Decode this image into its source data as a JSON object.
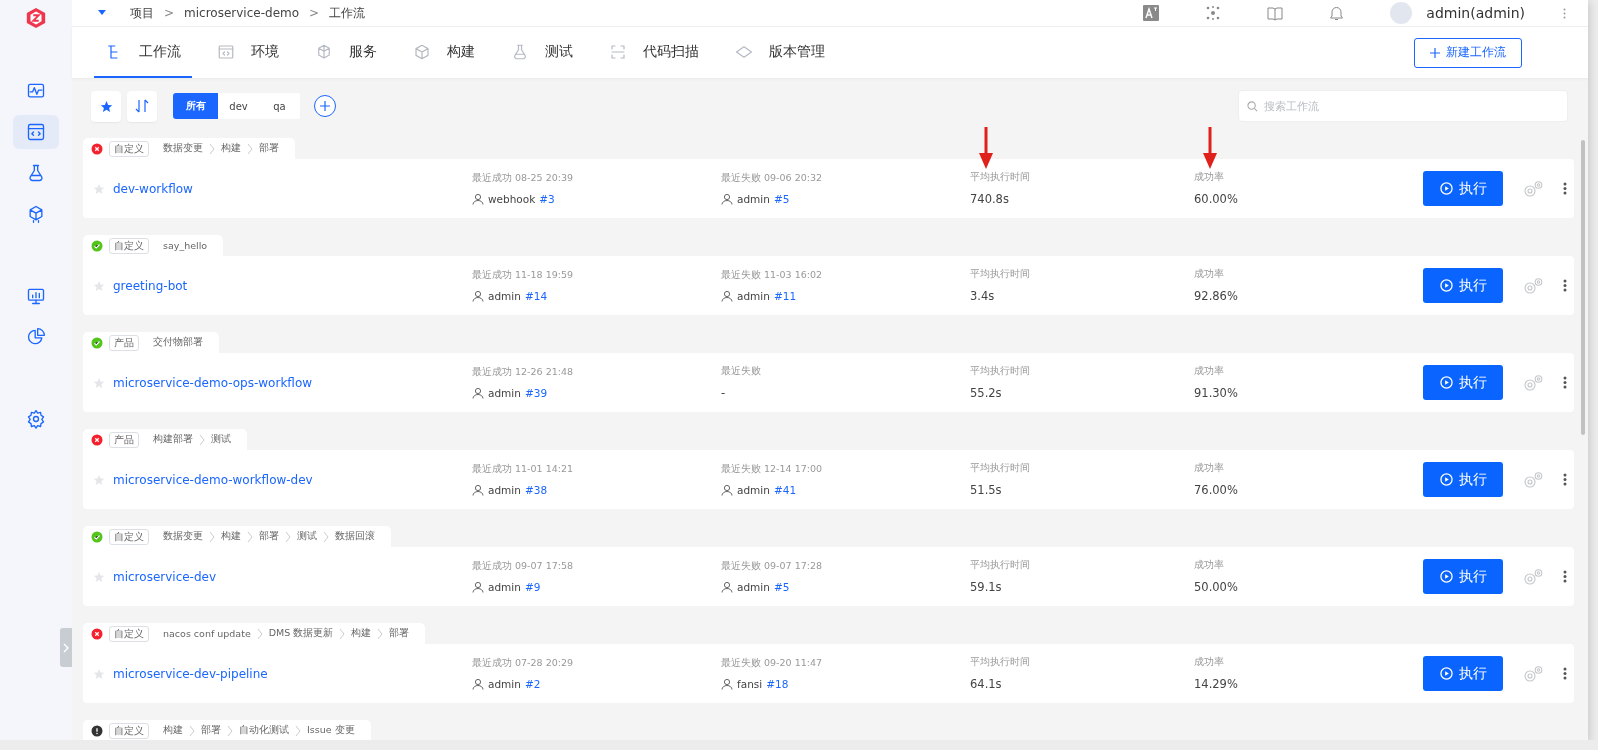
{
  "sidebar": {
    "groups": [
      [
        {
          "kind": "pulse",
          "selected": false
        },
        {
          "kind": "code",
          "selected": true
        },
        {
          "kind": "flask",
          "selected": false
        },
        {
          "kind": "cube",
          "selected": false
        }
      ],
      [
        {
          "kind": "monitor",
          "selected": false
        },
        {
          "kind": "pie",
          "selected": false
        }
      ],
      [
        {
          "kind": "gear",
          "selected": false
        }
      ]
    ]
  },
  "breadcrumb": {
    "separator": ">",
    "items": [
      "项目",
      "microservice-demo",
      "工作流"
    ]
  },
  "user": {
    "name": "admin(admin)"
  },
  "tabs": [
    {
      "label": "工作流",
      "kind": "workflow",
      "selected": true
    },
    {
      "label": "环境",
      "kind": "env",
      "selected": false
    },
    {
      "label": "服务",
      "kind": "service",
      "selected": false
    },
    {
      "label": "构建",
      "kind": "build",
      "selected": false
    },
    {
      "label": "测试",
      "kind": "test",
      "selected": false
    },
    {
      "label": "代码扫描",
      "kind": "scan",
      "selected": false
    },
    {
      "label": "版本管理",
      "kind": "version",
      "selected": false
    }
  ],
  "new_button": {
    "label": "新建工作流"
  },
  "filters": [
    {
      "label": "所有",
      "selected": true
    },
    {
      "label": "dev",
      "selected": false
    },
    {
      "label": "qa",
      "selected": false
    }
  ],
  "search": {
    "placeholder": "搜索工作流"
  },
  "workflows": [
    {
      "kind": "failed",
      "type": "自定义",
      "stages": [
        "数据变更",
        "构建",
        "部署"
      ],
      "name": "dev-workflow",
      "starred": false,
      "annotated": true,
      "last_success": {
        "label": "最近成功",
        "time": "08-25 20:39",
        "user": "webhook",
        "build": "#3"
      },
      "last_failure": {
        "label": "最近失败",
        "time": "09-06 20:32",
        "user": "admin",
        "build": "#5"
      },
      "avg_time": {
        "label": "平均执行时间",
        "value": "740.8s"
      },
      "success_rate": {
        "label": "成功率",
        "value": "60.00%"
      },
      "run_label": "执行"
    },
    {
      "kind": "success",
      "type": "自定义",
      "stages": [
        "say_hello"
      ],
      "name": "greeting-bot",
      "starred": false,
      "annotated": false,
      "last_success": {
        "label": "最近成功",
        "time": "11-18 19:59",
        "user": "admin",
        "build": "#14"
      },
      "last_failure": {
        "label": "最近失败",
        "time": "11-03 16:02",
        "user": "admin",
        "build": "#11"
      },
      "avg_time": {
        "label": "平均执行时间",
        "value": "3.4s"
      },
      "success_rate": {
        "label": "成功率",
        "value": "92.86%"
      },
      "run_label": "执行"
    },
    {
      "kind": "success",
      "type": "产品",
      "stages": [
        "交付物部署"
      ],
      "name": "microservice-demo-ops-workflow",
      "starred": false,
      "annotated": false,
      "last_success": {
        "label": "最近成功",
        "time": "12-26 21:48",
        "user": "admin",
        "build": "#39"
      },
      "last_failure": {
        "label": "最近失败",
        "value": "-"
      },
      "avg_time": {
        "label": "平均执行时间",
        "value": "55.2s"
      },
      "success_rate": {
        "label": "成功率",
        "value": "91.30%"
      },
      "run_label": "执行"
    },
    {
      "kind": "failed",
      "type": "产品",
      "stages": [
        "构建部署",
        "测试"
      ],
      "name": "microservice-demo-workflow-dev",
      "starred": false,
      "annotated": false,
      "last_success": {
        "label": "最近成功",
        "time": "11-01 14:21",
        "user": "admin",
        "build": "#38"
      },
      "last_failure": {
        "label": "最近失败",
        "time": "12-14 17:00",
        "user": "admin",
        "build": "#41"
      },
      "avg_time": {
        "label": "平均执行时间",
        "value": "51.5s"
      },
      "success_rate": {
        "label": "成功率",
        "value": "76.00%"
      },
      "run_label": "执行"
    },
    {
      "kind": "success",
      "type": "自定义",
      "stages": [
        "数据变更",
        "构建",
        "部署",
        "测试",
        "数据回滚"
      ],
      "name": "microservice-dev",
      "starred": false,
      "annotated": false,
      "last_success": {
        "label": "最近成功",
        "time": "09-07 17:58",
        "user": "admin",
        "build": "#9"
      },
      "last_failure": {
        "label": "最近失败",
        "time": "09-07 17:28",
        "user": "admin",
        "build": "#5"
      },
      "avg_time": {
        "label": "平均执行时间",
        "value": "59.1s"
      },
      "success_rate": {
        "label": "成功率",
        "value": "50.00%"
      },
      "run_label": "执行"
    },
    {
      "kind": "failed",
      "type": "自定义",
      "stages": [
        "nacos conf update",
        "DMS 数据更新",
        "构建",
        "部署"
      ],
      "name": "microservice-dev-pipeline",
      "starred": false,
      "annotated": false,
      "last_success": {
        "label": "最近成功",
        "time": "07-28 20:29",
        "user": "admin",
        "build": "#2"
      },
      "last_failure": {
        "label": "最近失败",
        "time": "09-20 11:47",
        "user": "fansi",
        "build": "#18"
      },
      "avg_time": {
        "label": "平均执行时间",
        "value": "64.1s"
      },
      "success_rate": {
        "label": "成功率",
        "value": "14.29%"
      },
      "run_label": "执行"
    },
    {
      "kind": "unknown",
      "type": "自定义",
      "stages": [
        "构建",
        "部署",
        "自动化测试",
        "Issue 变更"
      ]
    }
  ]
}
